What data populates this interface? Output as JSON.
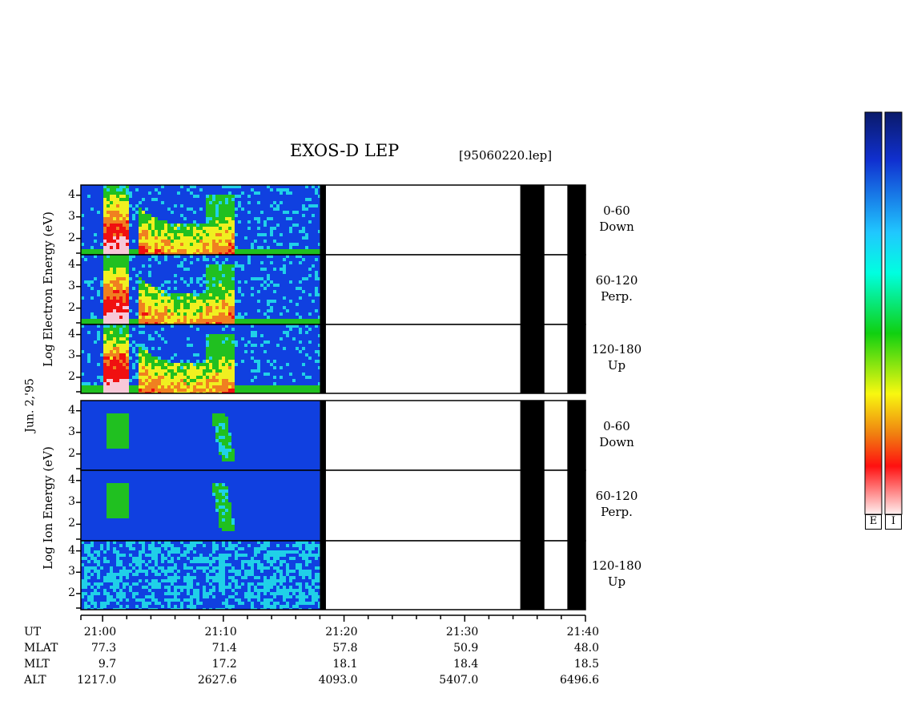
{
  "chart_data": {
    "type": "heatmap",
    "title": "EXOS-D LEP",
    "file_label": "[95060220.lep]",
    "date_label": "Jun. 2,'95",
    "electron_ylabel": "Log  Electron  Energy (eV)",
    "ion_ylabel": "Log  Ion  Energy (eV)",
    "y_ticks": [
      "4",
      "3",
      "2"
    ],
    "panels": [
      {
        "group": "electron",
        "range": "0-60",
        "dir": "Down"
      },
      {
        "group": "electron",
        "range": "60-120",
        "dir": "Perp."
      },
      {
        "group": "electron",
        "range": "120-180",
        "dir": "Up"
      },
      {
        "group": "ion",
        "range": "0-60",
        "dir": "Down"
      },
      {
        "group": "ion",
        "range": "60-120",
        "dir": "Perp."
      },
      {
        "group": "ion",
        "range": "120-180",
        "dir": "Up"
      }
    ],
    "x_axis": {
      "row_labels": [
        "UT",
        "MLAT",
        "MLT",
        "ALT"
      ],
      "ticks": [
        {
          "UT": "21:00",
          "MLAT": "77.3",
          "MLT": "9.7",
          "ALT": "1217.0"
        },
        {
          "UT": "21:10",
          "MLAT": "71.4",
          "MLT": "17.2",
          "ALT": "2627.6"
        },
        {
          "UT": "21:20",
          "MLAT": "57.8",
          "MLT": "18.1",
          "ALT": "4093.0"
        },
        {
          "UT": "21:30",
          "MLAT": "50.9",
          "MLT": "18.4",
          "ALT": "5407.0"
        },
        {
          "UT": "21:40",
          "MLAT": "48.0",
          "MLT": "18.5",
          "ALT": "6496.6"
        }
      ]
    },
    "data_gap_bands_ut": [
      [
        "21:18",
        "21:18.5"
      ],
      [
        "21:34.6",
        "21:36.6"
      ],
      [
        "21:38.5",
        "21:40"
      ]
    ],
    "data_end_ut": "21:18",
    "colorbar_labels": [
      "E",
      "I"
    ],
    "colors": {
      "low": "#0a1a7a",
      "blue": "#1040e0",
      "cyan": "#20d0e8",
      "green": "#20c020",
      "yellow": "#f0f020",
      "orange": "#f08020",
      "red": "#f01010",
      "pink": "#f8c8d8"
    }
  }
}
